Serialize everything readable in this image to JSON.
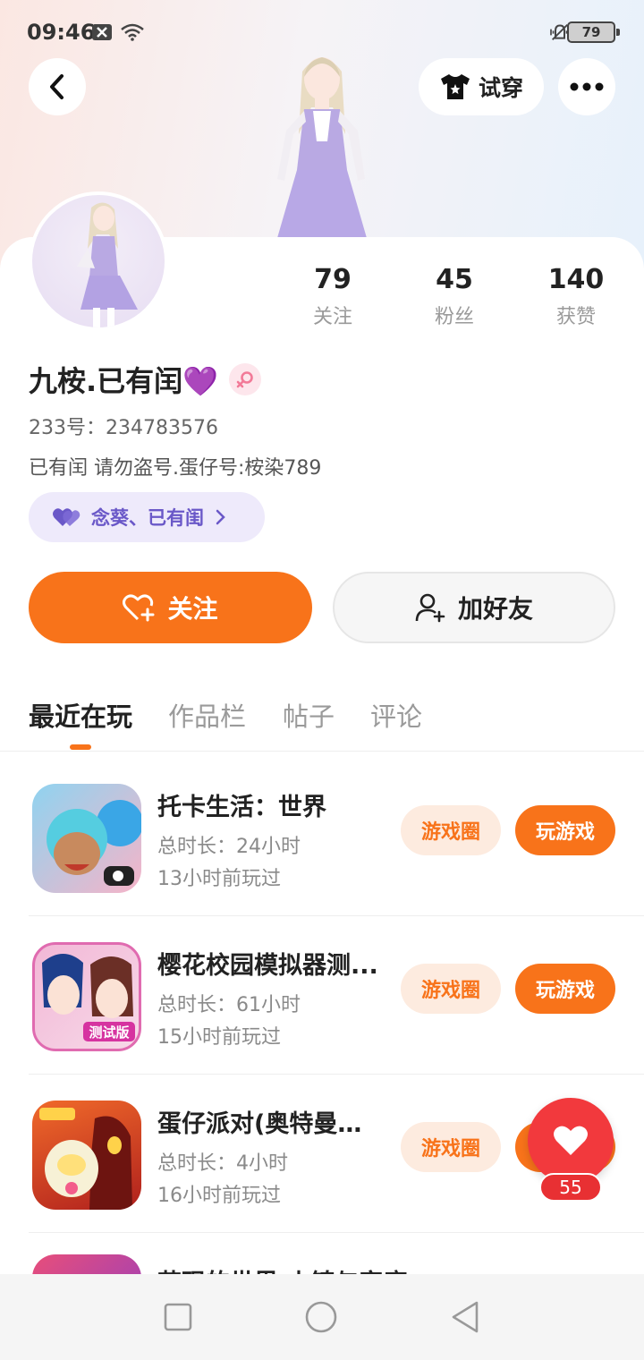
{
  "status_bar": {
    "time": "09:46",
    "battery": "79"
  },
  "header": {
    "try_on_label": "试穿"
  },
  "profile": {
    "name": "九桉.已有闰💜",
    "uid_label": "233号：234783576",
    "bio": "已有闰 请勿盗号.蛋仔号:桉染789",
    "tag_pill": "念葵、已有闺"
  },
  "stats": [
    {
      "num": "79",
      "label": "关注"
    },
    {
      "num": "45",
      "label": "粉丝"
    },
    {
      "num": "140",
      "label": "获赞"
    }
  ],
  "actions": {
    "follow_label": "关注",
    "add_friend_label": "加好友"
  },
  "tabs": [
    "最近在玩",
    "作品栏",
    "帖子",
    "评论"
  ],
  "games": [
    {
      "title": "托卡生活：世界",
      "duration": "总时长：24小时",
      "last": "13小时前玩过",
      "circle": "游戏圈",
      "play": "玩游戏"
    },
    {
      "title": "樱花校园模拟器测...",
      "duration": "总时长：61小时",
      "last": "15小时前玩过",
      "circle": "游戏圈",
      "play": "玩游戏"
    },
    {
      "title": "蛋仔派对(奥特曼联...",
      "duration": "总时长：4小时",
      "last": "16小时前玩过",
      "circle": "游戏圈",
      "play": "玩游戏"
    }
  ],
  "partial_game_title": "花现的世界 小镇与家庭",
  "like": {
    "count": "55"
  },
  "colors": {
    "accent": "#f8731a",
    "like": "#f2393d",
    "tag_text": "#6a58c8"
  }
}
